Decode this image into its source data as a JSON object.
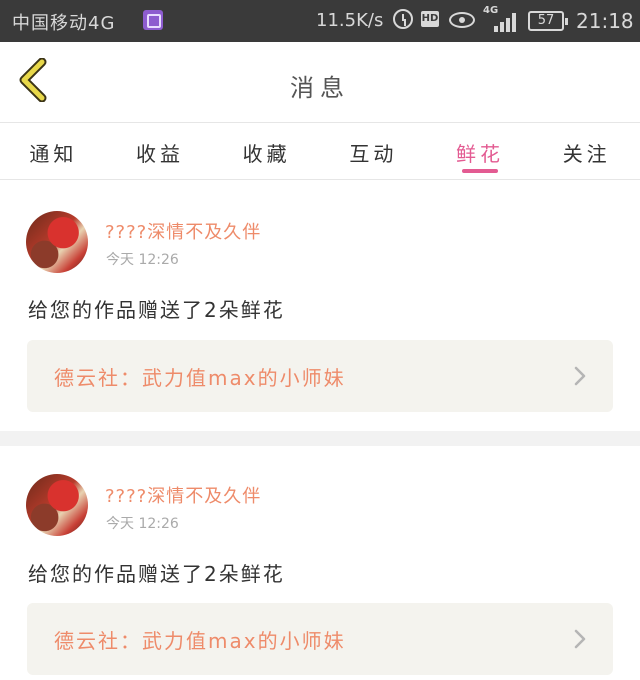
{
  "status_bar": {
    "carrier": "中国移动4G",
    "net_speed": "11.5K/s",
    "hd_label": "HD",
    "network_type": "4G",
    "battery": "57",
    "time": "21:18"
  },
  "header": {
    "title": "消息",
    "back_icon": "chevron-left-icon"
  },
  "tabs": [
    {
      "label": "通知",
      "active": false
    },
    {
      "label": "收益",
      "active": false
    },
    {
      "label": "收藏",
      "active": false
    },
    {
      "label": "互动",
      "active": false
    },
    {
      "label": "鲜花",
      "active": true
    },
    {
      "label": "关注",
      "active": false
    }
  ],
  "colors": {
    "accent": "#e35b92",
    "name": "#ee8b6a",
    "status_bar": "#3a3a3a"
  },
  "messages": [
    {
      "user_name": "????深情不及久伴",
      "time": "今天 12:26",
      "text": "给您的作品赠送了2朵鲜花",
      "work_title": "德云社：武力值max的小师妹"
    },
    {
      "user_name": "????深情不及久伴",
      "time": "今天 12:26",
      "text": "给您的作品赠送了2朵鲜花",
      "work_title": "德云社：武力值max的小师妹"
    }
  ]
}
